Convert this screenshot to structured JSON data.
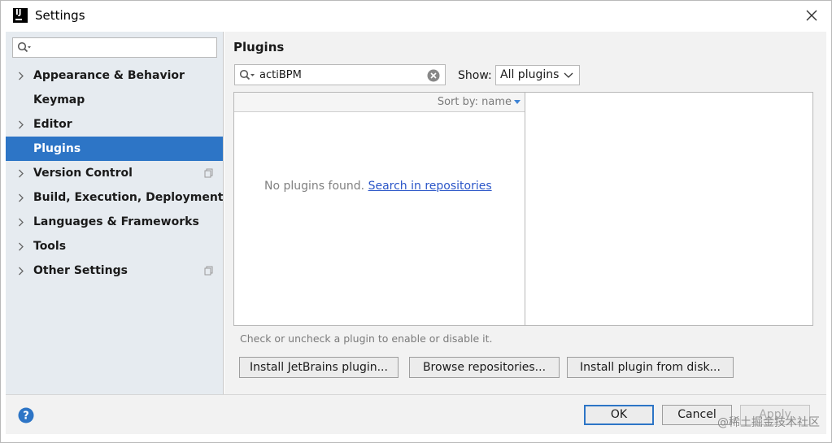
{
  "window": {
    "title": "Settings",
    "app_icon_letters": "IJ",
    "icons": {
      "app": "intellij-icon",
      "close": "close-icon"
    }
  },
  "sidebar": {
    "search_value": "",
    "items": [
      {
        "label": "Appearance & Behavior",
        "expandable": true,
        "selected": false,
        "project_icon": false
      },
      {
        "label": "Keymap",
        "expandable": false,
        "selected": false,
        "project_icon": false
      },
      {
        "label": "Editor",
        "expandable": true,
        "selected": false,
        "project_icon": false
      },
      {
        "label": "Plugins",
        "expandable": false,
        "selected": true,
        "project_icon": false
      },
      {
        "label": "Version Control",
        "expandable": true,
        "selected": false,
        "project_icon": true
      },
      {
        "label": "Build, Execution, Deployment",
        "expandable": true,
        "selected": false,
        "project_icon": false
      },
      {
        "label": "Languages & Frameworks",
        "expandable": true,
        "selected": false,
        "project_icon": false
      },
      {
        "label": "Tools",
        "expandable": true,
        "selected": false,
        "project_icon": false
      },
      {
        "label": "Other Settings",
        "expandable": true,
        "selected": false,
        "project_icon": true
      }
    ]
  },
  "main": {
    "title": "Plugins",
    "search_value": "actiBPM",
    "show_label": "Show:",
    "show_selected": "All plugins",
    "sort_label": "Sort by: name",
    "empty_text": "No plugins found.",
    "empty_link": "Search in repositories",
    "hint": "Check or uncheck a plugin to enable or disable it.",
    "buttons": {
      "install_jetbrains": "Install JetBrains plugin...",
      "browse": "Browse repositories...",
      "install_disk": "Install plugin from disk..."
    }
  },
  "footer": {
    "ok": "OK",
    "cancel": "Cancel",
    "apply": "Apply"
  },
  "watermark": "@稀土掘金技术社区",
  "colors": {
    "selection": "#2d75c6",
    "sidebar_bg": "#e6ebf0",
    "link": "#2b56c8"
  }
}
